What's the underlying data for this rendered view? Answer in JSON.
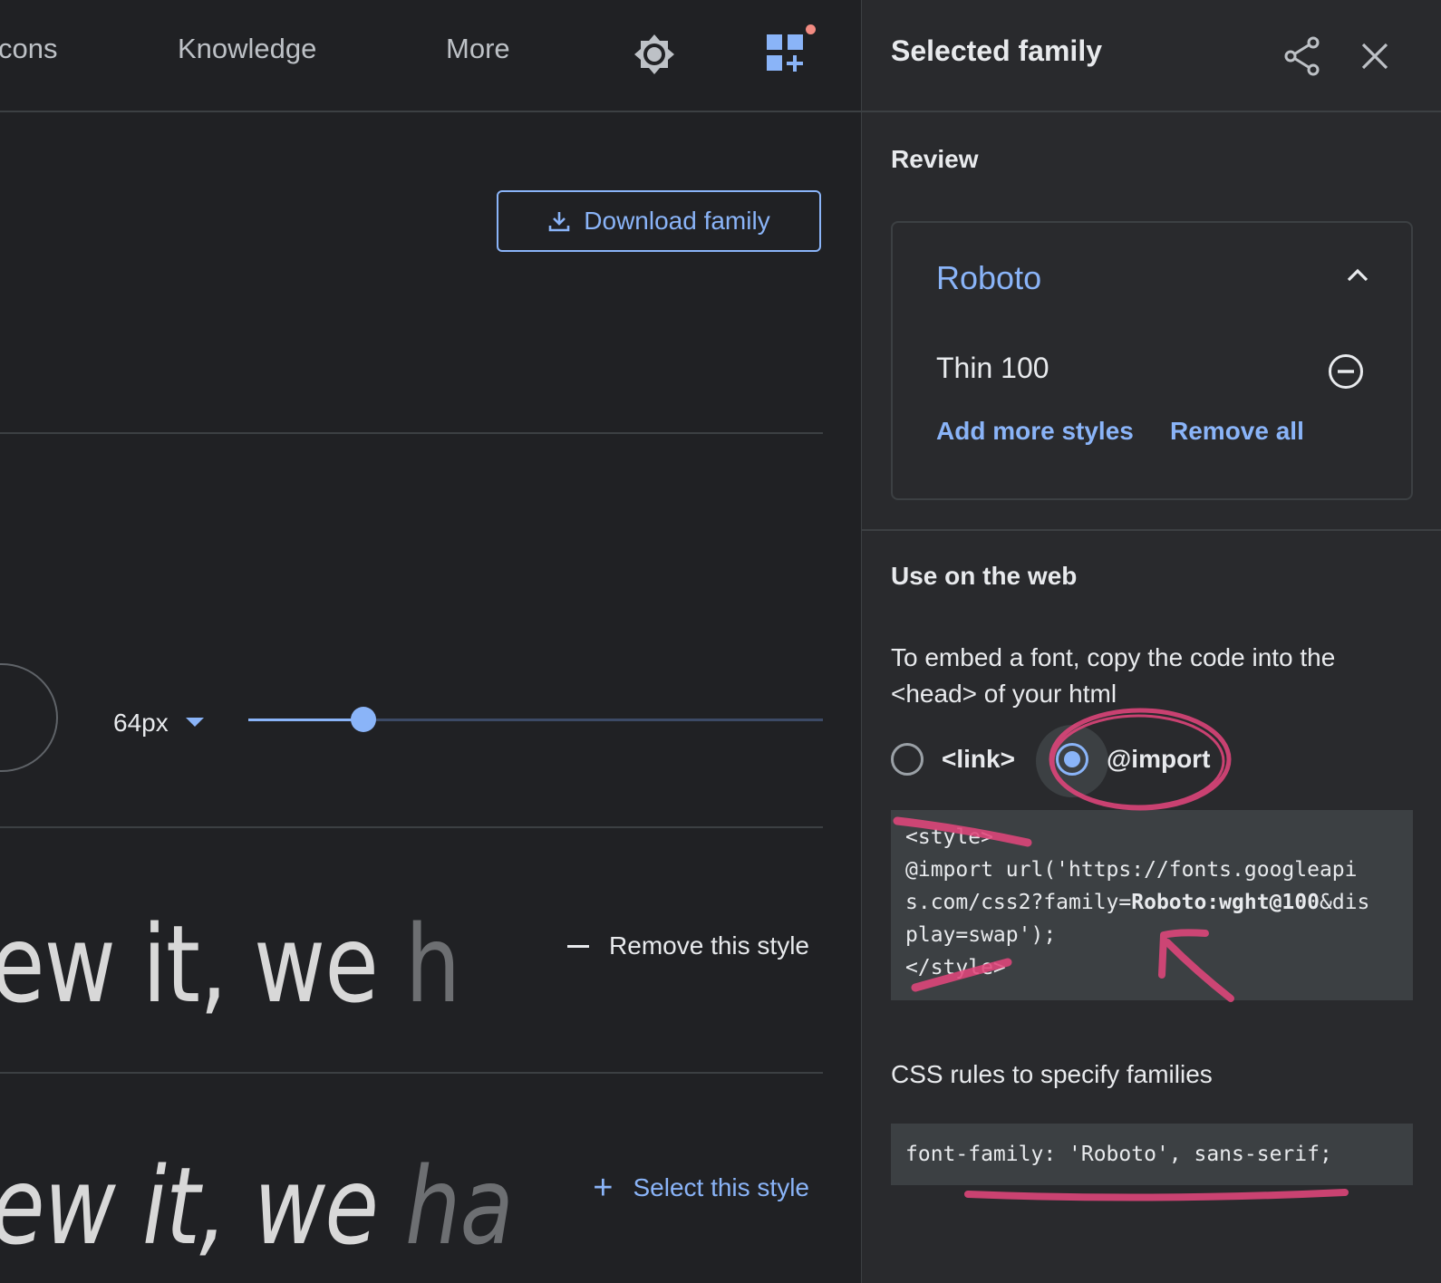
{
  "nav": {
    "items": [
      {
        "label": "cons"
      },
      {
        "label": "Knowledge"
      },
      {
        "label": "More"
      }
    ],
    "theme_icon": "brightness-icon",
    "apps_icon": "apps-add-icon"
  },
  "main": {
    "download_label": "Download family",
    "size_label": "64px",
    "slider_value_fraction": 0.2,
    "sample1_text": "ew it, we ",
    "sample1_faded": "h",
    "sample2_text": "ew it, we ",
    "sample2_faded": "ha",
    "remove_style_label": "Remove this style",
    "select_style_label": "Select this style"
  },
  "panel": {
    "title": "Selected family",
    "review_label": "Review",
    "family": {
      "name": "Roboto",
      "style": "Thin 100",
      "add_more_label": "Add more styles",
      "remove_all_label": "Remove all"
    },
    "web_label": "Use on the web",
    "embed_text": "To embed a font, copy the code into the <head> of your html",
    "radio_link_label": "<link>",
    "radio_import_label": "@import",
    "selected_option": "@import",
    "import_code": {
      "line1": "<style>",
      "line2": "@import url('https://fonts.googleapi",
      "line3_pre": "s.com/css2?family=",
      "line3_bold": "Roboto:wght@100",
      "line3_post": "&dis",
      "line4": "play=swap');",
      "line5": "</style>"
    },
    "css_rules_label": "CSS rules to specify families",
    "css_code": "font-family: 'Roboto', sans-serif;"
  },
  "colors": {
    "accent": "#8ab4f8",
    "annotation": "#e0457b",
    "background": "#202124",
    "panel": "#292a2d"
  }
}
